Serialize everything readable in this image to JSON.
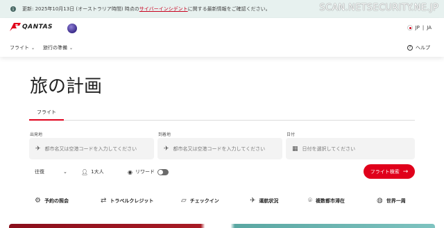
{
  "banner": {
    "prefix": "更新: 2025年10月13日 (オーストラリア時間) 時点の",
    "link": "サイバーインシデント",
    "suffix": "に関する最新情報をご確認ください。"
  },
  "watermark": "SCAN.NETSECURITY.NE.JP",
  "header": {
    "logo_text": "QANTAS",
    "lang_jp": "JP",
    "lang_sep": "|",
    "lang_ja": "JA",
    "nav": [
      "フライト",
      "旅行の準備"
    ],
    "help": "ヘルプ"
  },
  "page_title": "旅の計画",
  "tabs": [
    "フライト"
  ],
  "form": {
    "origin_label": "出発地",
    "origin_placeholder": "都市名又は空港コードを入力してください",
    "dest_label": "到着地",
    "dest_placeholder": "都市名又は空港コードを入力してください",
    "date_label": "日付",
    "date_placeholder": "日付を選択してください",
    "trip_type": "往復",
    "passengers": "1大人",
    "rewards": "リワード",
    "search_button": "フライト検索"
  },
  "quick_links": [
    "予約の照会",
    "トラベルクレジット",
    "チェックイン",
    "運航状況",
    "複数都市滞在",
    "世界一周"
  ],
  "colors": {
    "accent": "#e0001b",
    "banner_bg": "#e7f1ef"
  },
  "icons": [
    "info-icon",
    "kangaroo-icon",
    "oneworld-icon",
    "japan-flag-icon",
    "chevron-down-icon",
    "help-icon",
    "departure-icon",
    "arrival-icon",
    "calendar-icon",
    "person-icon",
    "reward-icon",
    "arrow-right-icon",
    "search-booking-icon",
    "credit-icon",
    "ticket-icon",
    "flight-status-icon",
    "multi-city-icon",
    "globe-icon"
  ]
}
